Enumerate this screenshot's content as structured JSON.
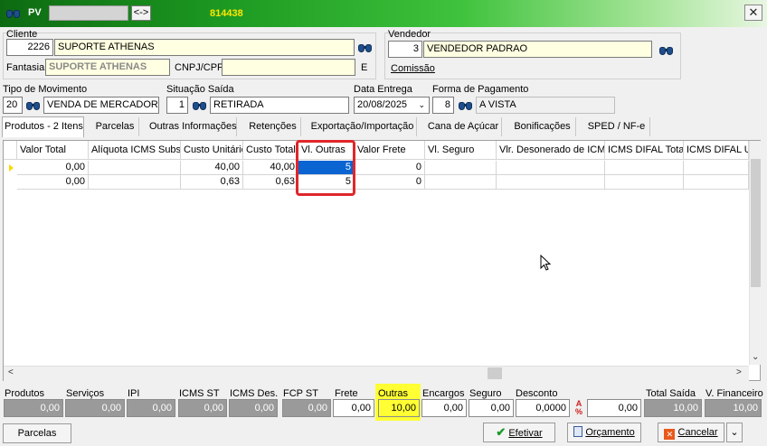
{
  "title_bar": {
    "module": "PV",
    "number": "814438",
    "nav_button": "<->",
    "close": "✕"
  },
  "cliente": {
    "group_label": "Cliente",
    "code": "2226",
    "name": "SUPORTE ATHENAS",
    "fantasia_label": "Fantasia",
    "fantasia": "SUPORTE ATHENAS",
    "cnpj_label": "CNPJ/CPF",
    "cnpj": "",
    "tipo_pessoa": "E"
  },
  "vendedor": {
    "group_label": "Vendedor",
    "code": "3",
    "name": "VENDEDOR PADRAO",
    "comissao_label": "Comissão"
  },
  "movimento": {
    "label": "Tipo de Movimento",
    "code": "20",
    "name": "VENDA DE MERCADORIA"
  },
  "situacao": {
    "label": "Situação Saída",
    "code": "1",
    "name": "RETIRADA"
  },
  "entrega": {
    "label": "Data Entrega",
    "date": "20/08/2025"
  },
  "pagamento": {
    "label": "Forma de Pagamento",
    "code": "8",
    "name": "A VISTA"
  },
  "tabs": [
    "Produtos - 2 Itens",
    "Parcelas",
    "Outras Informações",
    "Retenções",
    "Exportação/Importação",
    "Cana de Açúcar",
    "Bonificações",
    "SPED / NF-e"
  ],
  "grid": {
    "columns": [
      "Valor Total",
      "Alíquota ICMS Subst.",
      "Custo Unitário",
      "Custo Total",
      "Vl. Outras",
      "Valor Frete",
      "Vl. Seguro",
      "Vlr. Desonerado de ICMS",
      "ICMS DIFAL Total",
      "ICMS DIFAL U"
    ],
    "rows": [
      [
        "0,00",
        "",
        "40,00",
        "40,00",
        "5",
        "0",
        "",
        "",
        "",
        ""
      ],
      [
        "0,00",
        "",
        "0,63",
        "0,63",
        "5",
        "0",
        "",
        "",
        "",
        ""
      ]
    ]
  },
  "totals": {
    "labels": [
      "Produtos",
      "Serviços",
      "IPI",
      "ICMS ST",
      "ICMS Des.",
      "FCP ST",
      "Frete",
      "Outras",
      "Encargos",
      "Seguro",
      "Desconto",
      "Total Saída",
      "V. Financeiro"
    ],
    "values": [
      "0,00",
      "0,00",
      "0,00",
      "0,00",
      "0,00",
      "0,00",
      "0,00",
      "10,00",
      "0,00",
      "0,00",
      "0,0000",
      "0,00",
      "10,00",
      "10,00"
    ]
  },
  "buttons": {
    "parcelas": "Parcelas",
    "efetivar": "Efetivar",
    "orcamento": "Orçamento",
    "cancelar": "Cancelar"
  },
  "colors": {
    "accent_green": "#1d9a22",
    "selection": "#0a64d2",
    "highlight_red": "#e0262b",
    "highlight_yellow": "#ffff33"
  }
}
